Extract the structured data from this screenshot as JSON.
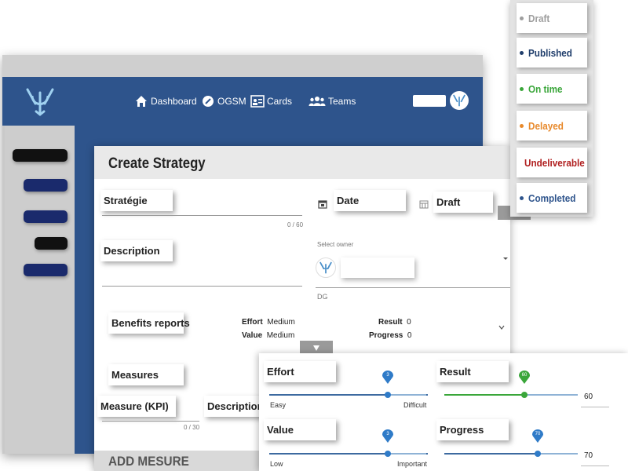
{
  "nav": {
    "dashboard": "Dashboard",
    "ogsm": "OGSM",
    "cards": "Cards",
    "teams": "Teams"
  },
  "form": {
    "title": "Create Strategy",
    "strategie_label": "Stratégie",
    "strategie_counter": "0 / 60",
    "date_label": "Date",
    "status_label": "Draft",
    "description_label": "Description",
    "owner_placeholder": "Select owner",
    "owner_initials": "DG",
    "benefits_label": "Benefits reports",
    "effort_key": "Effort",
    "effort_value": "Medium",
    "value_key": "Value",
    "value_value": "Medium",
    "result_key": "Result",
    "result_value": "0",
    "progress_key": "Progress",
    "progress_value": "0",
    "measures_label": "Measures",
    "measure_kpi_label": "Measure (KPI)",
    "measure_description_label": "Description",
    "measure_counter": "0 / 30",
    "add_measure": "ADD MESURE"
  },
  "status_options": [
    {
      "label": "Draft",
      "color": "#9e9e9e"
    },
    {
      "label": "Published",
      "color": "#1f3d6b"
    },
    {
      "label": "On time",
      "color": "#3aa63a"
    },
    {
      "label": "Delayed",
      "color": "#e8892b"
    },
    {
      "label": "Undeliverable",
      "color": "#b01e1e"
    },
    {
      "label": "Completed",
      "color": "#2e548c"
    }
  ],
  "sliders": {
    "effort": {
      "label": "Effort",
      "value": 3,
      "min": 0,
      "max": 4,
      "min_label": "Easy",
      "max_label": "Difficult"
    },
    "value": {
      "label": "Value",
      "value": 3,
      "min": 0,
      "max": 4,
      "min_label": "Low",
      "max_label": "Important"
    },
    "result": {
      "label": "Result",
      "value": 60,
      "max": 100,
      "display": "60"
    },
    "progress": {
      "label": "Progress",
      "value": 70,
      "max": 100,
      "display": "70"
    }
  },
  "colors": {
    "brand_blue": "#2e548c",
    "slider_blue": "#2f7bc8",
    "result_green": "#3aa63a"
  }
}
